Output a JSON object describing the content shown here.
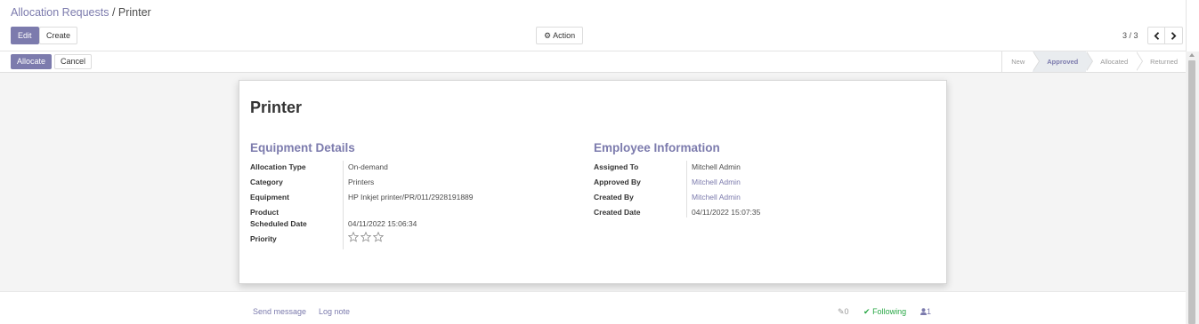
{
  "breadcrumb": {
    "parent": "Allocation Requests",
    "separator": " / ",
    "current": "Printer"
  },
  "toolbar": {
    "edit_label": "Edit",
    "create_label": "Create",
    "action_label": "Action"
  },
  "pager": {
    "value": "3 / 3"
  },
  "statusbar": {
    "allocate_label": "Allocate",
    "cancel_label": "Cancel",
    "stages": [
      {
        "label": "New",
        "active": false
      },
      {
        "label": "Approved",
        "active": true
      },
      {
        "label": "Allocated",
        "active": false
      },
      {
        "label": "Returned",
        "active": false
      }
    ]
  },
  "record": {
    "title": "Printer"
  },
  "equipment_details": {
    "title": "Equipment Details",
    "fields": [
      {
        "label": "Allocation Type",
        "value": "On-demand"
      },
      {
        "label": "Category",
        "value": "Printers"
      },
      {
        "label": "Equipment",
        "value": "HP Inkjet printer/PR/011/2928191889"
      },
      {
        "label": "Product",
        "value": ""
      },
      {
        "label": "Scheduled Date",
        "value": "04/11/2022 15:06:34"
      },
      {
        "label": "Priority",
        "stars": 0,
        "max_stars": 3
      }
    ]
  },
  "employee_info": {
    "title": "Employee Information",
    "fields": [
      {
        "label": "Assigned To",
        "value": "Mitchell Admin"
      },
      {
        "label": "Approved By",
        "value": "Mitchell Admin"
      },
      {
        "label": "Created By",
        "value": "Mitchell Admin"
      },
      {
        "label": "Created Date",
        "value": "04/11/2022 15:07:35"
      }
    ]
  },
  "chatter": {
    "send_message": "Send message",
    "log_note": "Log note",
    "attachments": "0",
    "following": "Following",
    "followers": "1"
  },
  "colors": {
    "primary": "#7c7bad",
    "following": "#28a745"
  }
}
